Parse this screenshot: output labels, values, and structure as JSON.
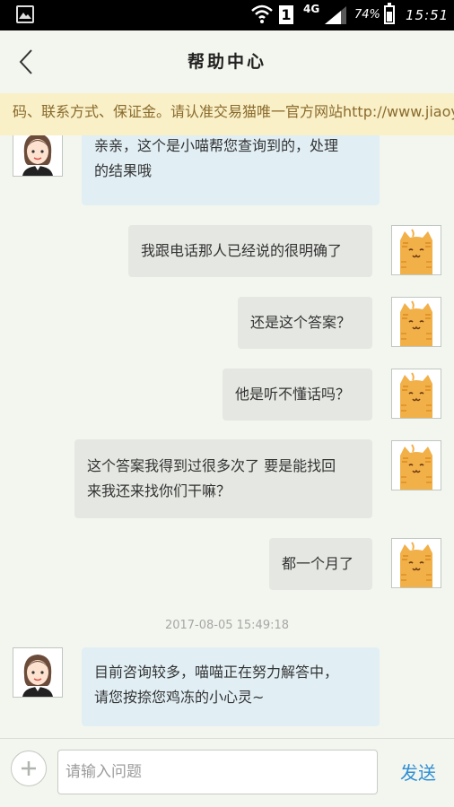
{
  "status_bar": {
    "network": "4G",
    "sim_slot": "1",
    "battery_pct": "74%",
    "battery_level": 0.74,
    "time": "15:51",
    "icons": [
      "gallery-icon",
      "wifi-icon",
      "signal-icon",
      "battery-icon"
    ]
  },
  "header": {
    "title": "帮助中心",
    "back_icon": "chevron-left-icon"
  },
  "notice": {
    "text": "码、联系方式、保证金。请认准交易猫唯一官方网站http://www.jiaoyimao.com"
  },
  "messages": [
    {
      "side": "left",
      "sender": "agent",
      "lines": [
        "亲亲，这个是小喵帮您查询到的，处理",
        "的结果哦"
      ]
    },
    {
      "side": "right",
      "sender": "user",
      "lines": [
        "我跟电话那人已经说的很明确了"
      ]
    },
    {
      "side": "right",
      "sender": "user",
      "lines": [
        "还是这个答案？"
      ]
    },
    {
      "side": "right",
      "sender": "user",
      "lines": [
        "他是听不懂话吗？"
      ]
    },
    {
      "side": "right",
      "sender": "user",
      "lines": [
        "这个答案我得到过很多次了 要是能找回",
        "来我还来找你们干嘛？"
      ]
    },
    {
      "side": "right",
      "sender": "user",
      "lines": [
        "都一个月了"
      ]
    },
    {
      "type": "timestamp",
      "text": "2017-08-05 15:49:18"
    },
    {
      "side": "left",
      "sender": "agent",
      "lines": [
        "目前咨询较多，喵喵正在努力解答中，",
        "请您按捺您鸡冻的小心灵~"
      ]
    }
  ],
  "input_bar": {
    "placeholder": "请输入问题",
    "send_label": "发送",
    "plus_icon": "plus-icon"
  },
  "colors": {
    "background": "#f3f6ee",
    "agent_bubble": "#e1eff5",
    "user_bubble": "#e5e8e2",
    "notice_bg": "#f9f0c8",
    "notice_text": "#8a6a2c",
    "send_blue": "#2f8fd6",
    "cat_orange": "#f2b049"
  }
}
